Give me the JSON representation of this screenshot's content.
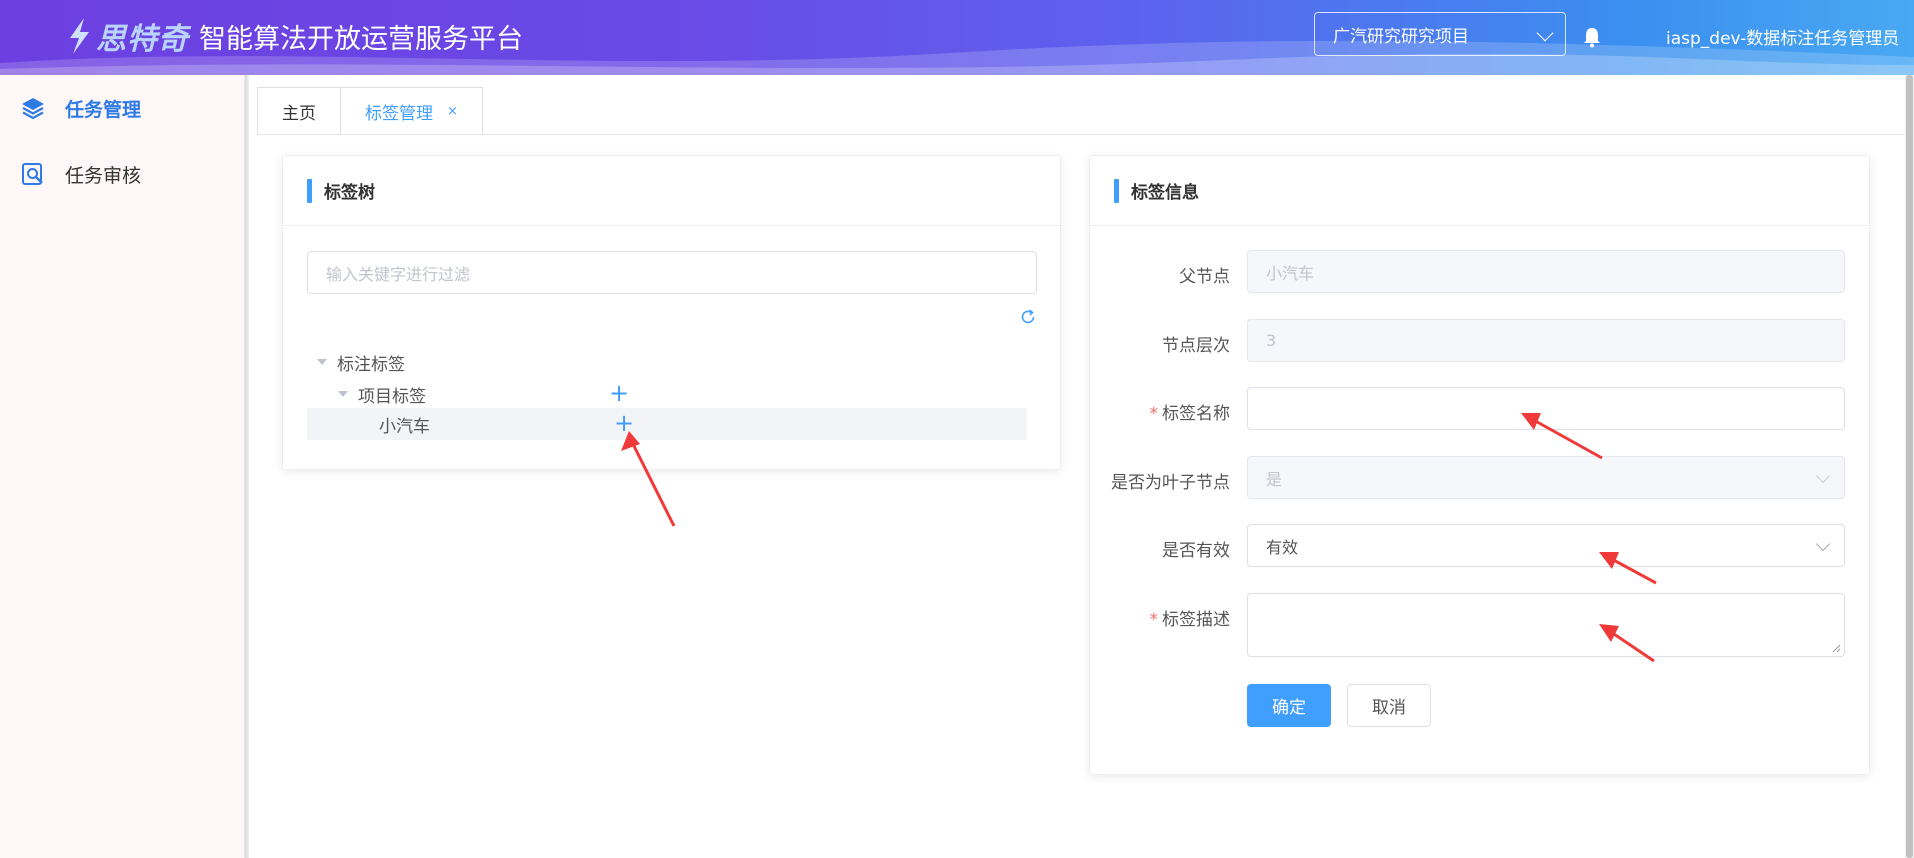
{
  "header": {
    "brand": "思特奇",
    "title": "智能算法开放运营服务平台",
    "project_select": "广汽研究研究项目",
    "user": "iasp_dev-数据标注任务管理员",
    "bell_icon": "bell-icon"
  },
  "sidebar": {
    "items": [
      {
        "label": "任务管理",
        "icon": "layers-icon",
        "active": true
      },
      {
        "label": "任务审核",
        "icon": "search-document-icon",
        "active": false
      }
    ]
  },
  "tabs": [
    {
      "label": "主页",
      "active": false
    },
    {
      "label": "标签管理",
      "active": true,
      "close": "×"
    }
  ],
  "tree_panel": {
    "title": "标签树",
    "filter_placeholder": "输入关键字进行过滤",
    "nodes": [
      {
        "label": "标注标签",
        "level": 1,
        "expanded": true
      },
      {
        "label": "项目标签",
        "level": 2,
        "expanded": true
      },
      {
        "label": "小汽车",
        "level": 3,
        "selected": true
      }
    ],
    "add_symbol": "+"
  },
  "info_panel": {
    "title": "标签信息",
    "parent_label": "父节点",
    "parent_value": "小汽车",
    "level_label": "节点层次",
    "level_value": "3",
    "name_label": "标签名称",
    "name_value": "",
    "leaf_label": "是否为叶子节点",
    "leaf_value": "是",
    "valid_label": "是否有效",
    "valid_value": "有效",
    "desc_label": "标签描述",
    "desc_value": "",
    "required_mark": "*",
    "confirm": "确定",
    "cancel": "取消"
  },
  "colors": {
    "primary": "#409eff",
    "active_nav": "#2d7be5",
    "annotation_arrow": "#f03a3a"
  }
}
